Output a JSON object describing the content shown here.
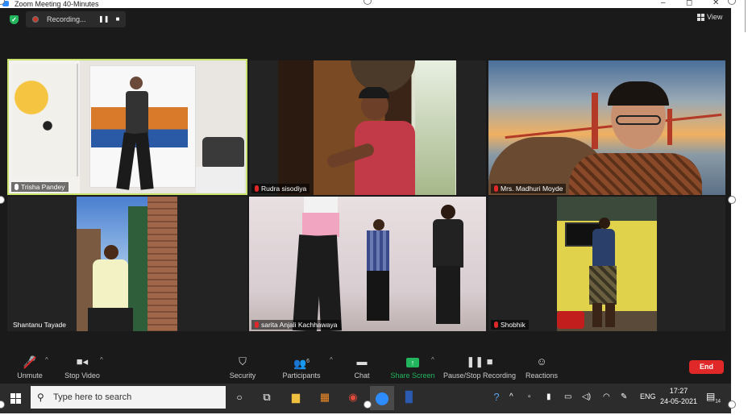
{
  "window": {
    "title": "Zoom Meeting 40-Minutes",
    "controls": [
      "–",
      "◻",
      "✕"
    ]
  },
  "topbar": {
    "recording_label": "Recording...",
    "view_label": "View"
  },
  "participants": [
    {
      "name": "Trisha Pandey",
      "muted": false
    },
    {
      "name": "Rudra sisodiya",
      "muted": true
    },
    {
      "name": "Mrs. Madhuri Moyde",
      "muted": true
    },
    {
      "name": "Shantanu Tayade",
      "muted": false
    },
    {
      "name": "sarita Anjali Kachhawaya",
      "muted": true
    },
    {
      "name": "Shobhik",
      "muted": true
    }
  ],
  "controls": {
    "unmute": "Unmute",
    "stop_video": "Stop Video",
    "security": "Security",
    "participants": "Participants",
    "participants_count": "6",
    "chat": "Chat",
    "share_screen": "Share Screen",
    "pause_recording": "Pause/Stop Recording",
    "reactions": "Reactions",
    "end": "End"
  },
  "taskbar": {
    "search_placeholder": "Type here to search",
    "language": "ENG",
    "time": "17:27",
    "date": "24-05-2021",
    "notification_count": "14"
  },
  "colors": {
    "accent_green": "#23b55e",
    "end_red": "#e02828",
    "speaker_border": "#c8e36b",
    "zoom_blue": "#2d8cff"
  }
}
